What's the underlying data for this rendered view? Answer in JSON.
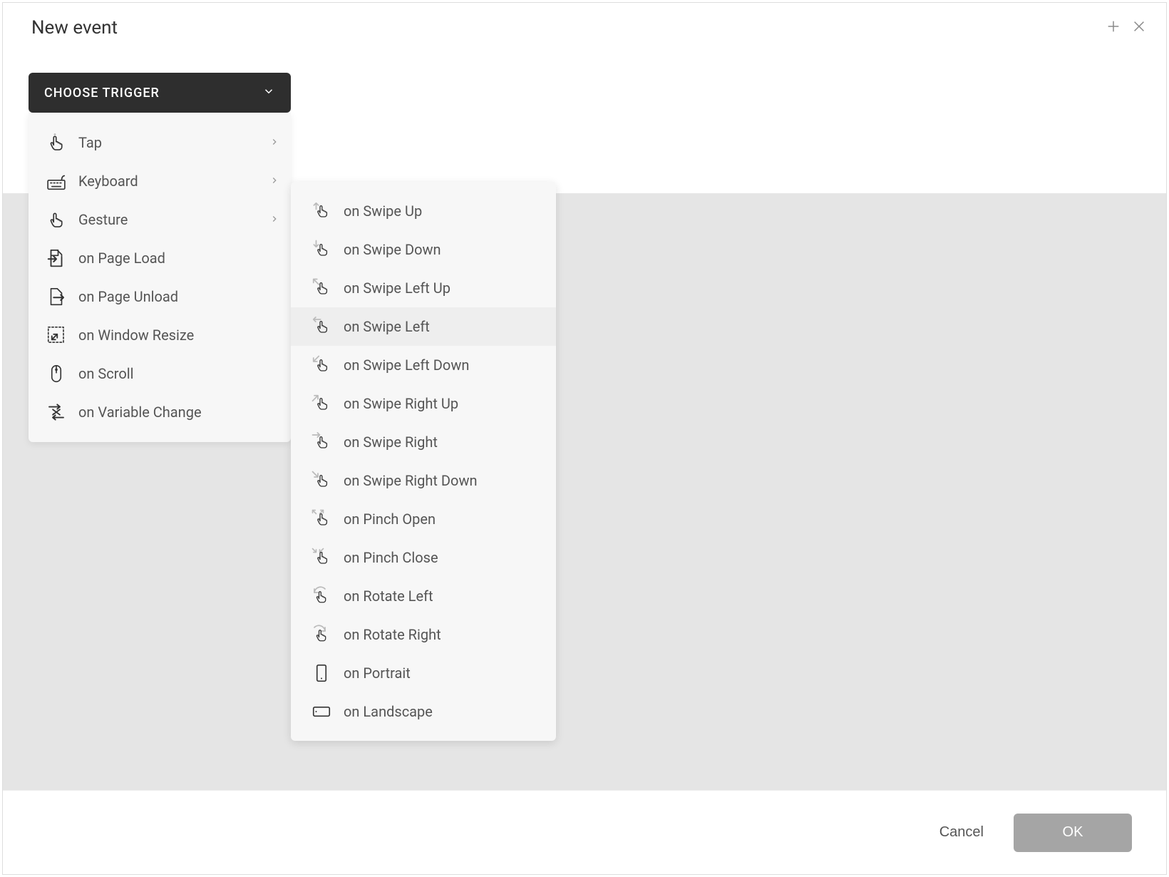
{
  "header": {
    "title": "New event"
  },
  "trigger": {
    "button_label": "CHOOSE TRIGGER"
  },
  "primary_menu": {
    "items": [
      {
        "label": "Tap",
        "icon": "tap-icon",
        "submenu": true
      },
      {
        "label": "Keyboard",
        "icon": "keyboard-icon",
        "submenu": true
      },
      {
        "label": "Gesture",
        "icon": "gesture-icon",
        "submenu": true
      },
      {
        "label": "on Page Load",
        "icon": "page-load-icon",
        "submenu": false
      },
      {
        "label": "on Page Unload",
        "icon": "page-unload-icon",
        "submenu": false
      },
      {
        "label": "on Window Resize",
        "icon": "window-resize-icon",
        "submenu": false
      },
      {
        "label": "on Scroll",
        "icon": "scroll-icon",
        "submenu": false
      },
      {
        "label": "on Variable Change",
        "icon": "variable-change-icon",
        "submenu": false
      }
    ]
  },
  "secondary_menu": {
    "highlighted_index": 3,
    "items": [
      {
        "label": "on Swipe Up",
        "icon": "swipe-up-icon"
      },
      {
        "label": "on Swipe Down",
        "icon": "swipe-down-icon"
      },
      {
        "label": "on Swipe Left Up",
        "icon": "swipe-left-up-icon"
      },
      {
        "label": "on Swipe Left",
        "icon": "swipe-left-icon"
      },
      {
        "label": "on Swipe Left Down",
        "icon": "swipe-left-down-icon"
      },
      {
        "label": "on Swipe Right Up",
        "icon": "swipe-right-up-icon"
      },
      {
        "label": "on Swipe Right",
        "icon": "swipe-right-icon"
      },
      {
        "label": "on Swipe Right Down",
        "icon": "swipe-right-down-icon"
      },
      {
        "label": "on Pinch Open",
        "icon": "pinch-open-icon"
      },
      {
        "label": "on Pinch Close",
        "icon": "pinch-close-icon"
      },
      {
        "label": "on Rotate Left",
        "icon": "rotate-left-icon"
      },
      {
        "label": "on Rotate Right",
        "icon": "rotate-right-icon"
      },
      {
        "label": "on Portrait",
        "icon": "portrait-icon"
      },
      {
        "label": "on Landscape",
        "icon": "landscape-icon"
      }
    ]
  },
  "footer": {
    "cancel_label": "Cancel",
    "ok_label": "OK"
  }
}
